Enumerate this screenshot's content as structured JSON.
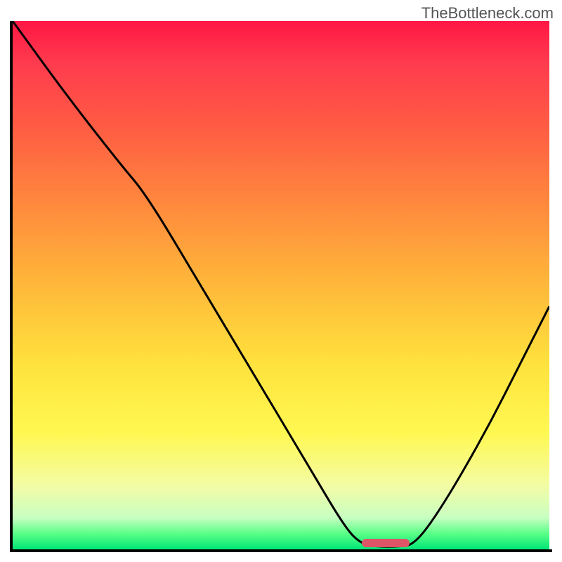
{
  "watermark": "TheBottleneck.com",
  "chart_data": {
    "type": "line",
    "title": "",
    "xlabel": "",
    "ylabel": "",
    "xlim": [
      0,
      100
    ],
    "ylim": [
      0,
      100
    ],
    "curve_points": [
      {
        "x": 0,
        "y": 100
      },
      {
        "x": 10,
        "y": 86
      },
      {
        "x": 20,
        "y": 73
      },
      {
        "x": 25,
        "y": 67
      },
      {
        "x": 35,
        "y": 50
      },
      {
        "x": 45,
        "y": 33
      },
      {
        "x": 55,
        "y": 16
      },
      {
        "x": 62,
        "y": 4
      },
      {
        "x": 65,
        "y": 1
      },
      {
        "x": 68,
        "y": 0.5
      },
      {
        "x": 72,
        "y": 0.5
      },
      {
        "x": 75,
        "y": 1
      },
      {
        "x": 80,
        "y": 8
      },
      {
        "x": 88,
        "y": 22
      },
      {
        "x": 95,
        "y": 36
      },
      {
        "x": 100,
        "y": 46
      }
    ],
    "optimal_marker": {
      "x_start": 65,
      "x_end": 74,
      "y": 1.2,
      "color": "#dd5566"
    },
    "gradient_stops": [
      {
        "pos": 0,
        "color": "#ff1744"
      },
      {
        "pos": 50,
        "color": "#ffd23a"
      },
      {
        "pos": 100,
        "color": "#00e676"
      }
    ]
  }
}
